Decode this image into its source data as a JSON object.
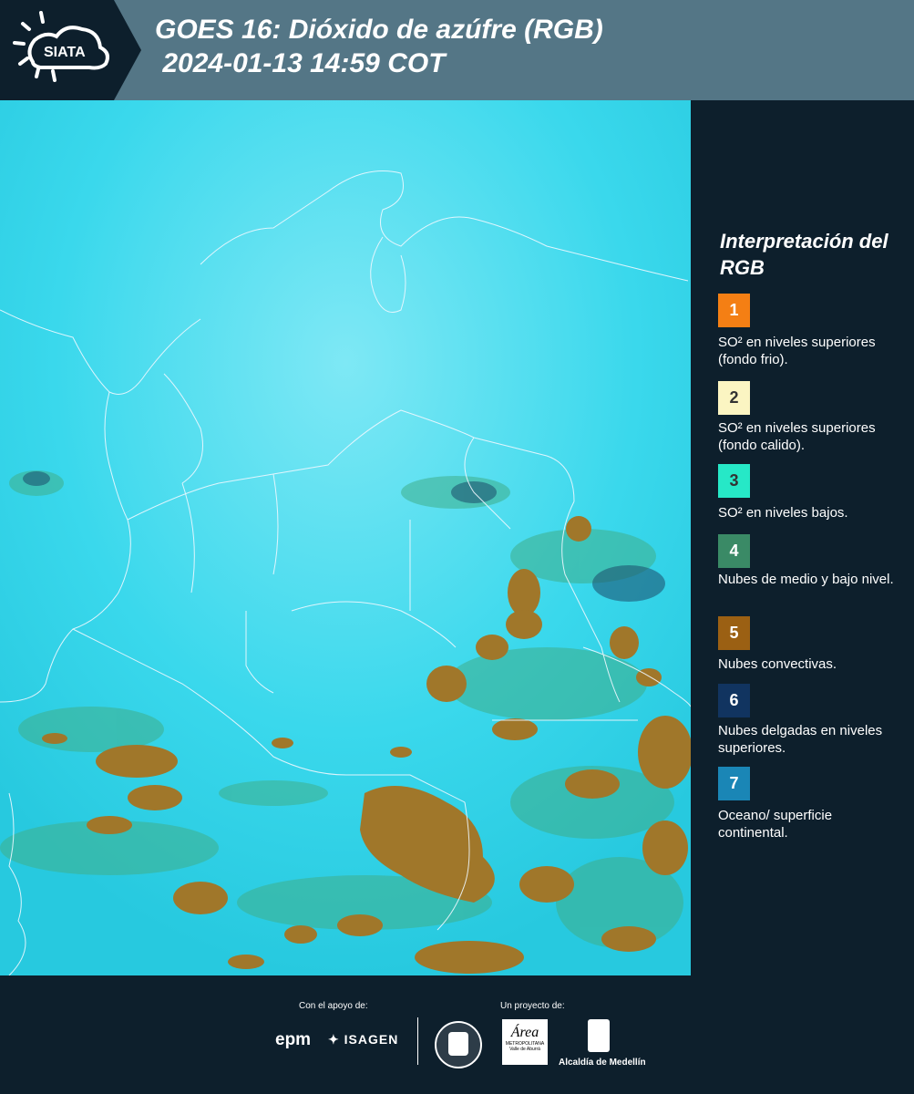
{
  "header": {
    "logo_text": "SIATA",
    "title_line1": "GOES 16: Dióxido de azúfre (RGB)",
    "title_line2": " 2024-01-13 14:59 COT"
  },
  "legend": {
    "title": "Interpretación del RGB",
    "items": [
      {
        "num": "1",
        "color": "#f47f14",
        "label": "SO² en niveles superiores (fondo frio)."
      },
      {
        "num": "2",
        "color": "#fbf5c2",
        "label": "SO² en niveles superiores (fondo calido)."
      },
      {
        "num": "3",
        "color": "#26e8c7",
        "label": "SO² en niveles bajos."
      },
      {
        "num": "4",
        "color": "#3a8a66",
        "label": "Nubes de medio y bajo nivel."
      },
      {
        "num": "5",
        "color": "#9b6013",
        "label": "Nubes convectivas."
      },
      {
        "num": "6",
        "color": "#113460",
        "label": "Nubes delgadas en niveles superiores."
      },
      {
        "num": "7",
        "color": "#1a86b6",
        "label": "Oceano/ superficie continental."
      }
    ]
  },
  "footer": {
    "support_label": "Con el apoyo de:",
    "project_label": "Un proyecto de:",
    "logo_epm": "epm",
    "logo_isagen": "ISAGEN",
    "logo_area": "Área",
    "logo_area_sub": "METROPOLITANA",
    "logo_area_sub2": "Valle de Aburrá",
    "logo_alcaldia": "Alcaldía de Medellín"
  },
  "colors": {
    "background": "#0d1f2c",
    "header": "#547686",
    "map_base": "#2ed7ee",
    "cloud_brown": "#a0772a"
  }
}
